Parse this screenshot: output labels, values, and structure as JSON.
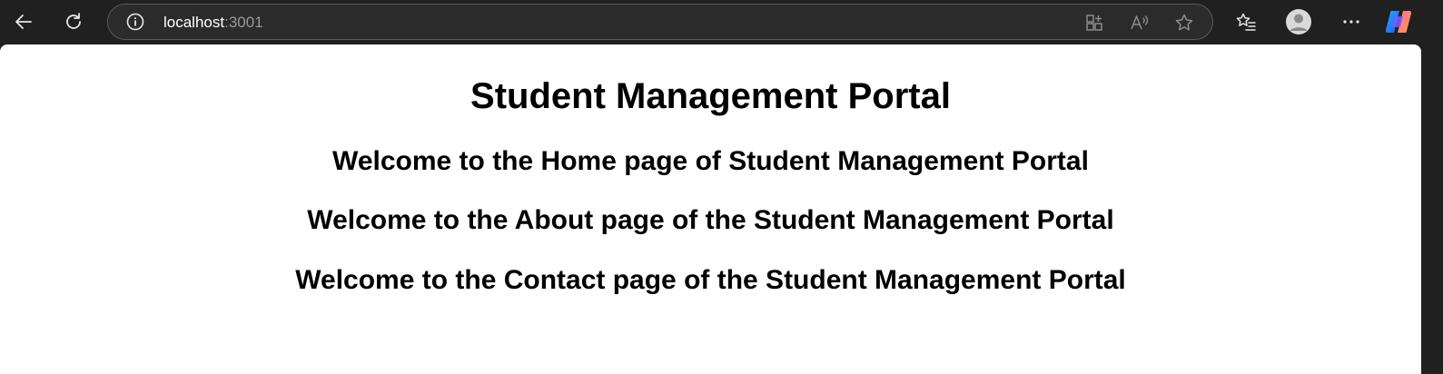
{
  "browser": {
    "url_host": "localhost",
    "url_port": ":3001"
  },
  "page": {
    "title": "Student Management Portal",
    "headings": [
      "Welcome to the Home page of Student Management Portal",
      "Welcome to the About page of the Student Management Portal",
      "Welcome to the Contact page of the Student Management Portal"
    ]
  },
  "colors": {
    "chrome_bg": "#202020",
    "addressbar_bg": "#2b2b2b",
    "page_bg": "#ffffff",
    "text": "#000000"
  }
}
